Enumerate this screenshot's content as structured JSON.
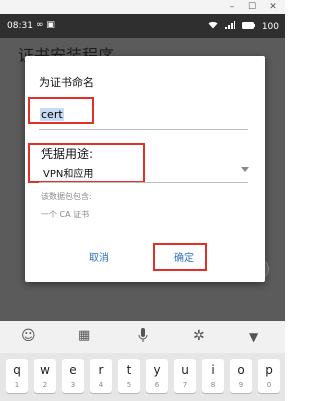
{
  "window": {
    "minimize_label": "–",
    "maximize_label": "☐",
    "close_label": "✕"
  },
  "status_bar": {
    "time": "08:31",
    "left_icons": "∞ ▣",
    "wifi_icon": "wifi-icon",
    "signal_icon": "signal-icon",
    "battery": "100"
  },
  "background": {
    "title": "证书安装程序",
    "side_button_glyph": "›"
  },
  "dialog": {
    "title": "为证书命名",
    "name_value": "cert",
    "use_label": "凭据用途:",
    "use_value": "VPN和应用",
    "package_note": "该数据包包含:",
    "package_content": "一个 CA 证书",
    "cancel_label": "取消",
    "ok_label": "确定",
    "highlight_color": "#e0302a",
    "accent_color": "#2f72c6"
  },
  "keyboard": {
    "toolbar_icons": [
      "emoji-icon",
      "keyboard-grid-icon",
      "microphone-icon",
      "gear-icon",
      "collapse-keyboard-icon"
    ],
    "keys": [
      {
        "letter": "q",
        "digit": "1"
      },
      {
        "letter": "w",
        "digit": "2"
      },
      {
        "letter": "e",
        "digit": "3"
      },
      {
        "letter": "r",
        "digit": "4"
      },
      {
        "letter": "t",
        "digit": "5"
      },
      {
        "letter": "y",
        "digit": "6"
      },
      {
        "letter": "u",
        "digit": "7"
      },
      {
        "letter": "i",
        "digit": "8"
      },
      {
        "letter": "o",
        "digit": "9"
      },
      {
        "letter": "p",
        "digit": "0"
      }
    ]
  }
}
